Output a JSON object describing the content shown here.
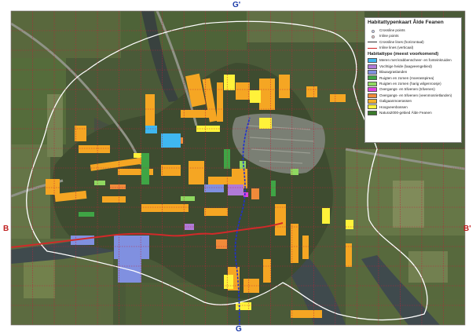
{
  "labels": {
    "top": "G'",
    "bottom": "G",
    "left": "B",
    "right": "B'"
  },
  "legend": {
    "title": "Habitattypenkaart Âlde Feanen",
    "line_items": [
      {
        "label": "Crossline points",
        "kind": "point",
        "color": "#cfd8ff"
      },
      {
        "label": "Inline points",
        "kind": "point",
        "color": "#ffd0d0"
      },
      {
        "label": "Crossline lines (horizontaal)",
        "kind": "line",
        "color": "#333333"
      },
      {
        "label": "Inline lines (verticaal)",
        "kind": "line",
        "color": "#d02020"
      }
    ],
    "subtitle": "Habitattype (meest voorkomend)",
    "habitat_items": [
      {
        "label": "Meren met krabbenscheer- en fonteinkruiden",
        "color": "#3fb7f0"
      },
      {
        "label": "Vochtige heide (laagveengebied)",
        "color": "#b07ad8"
      },
      {
        "label": "Blauwgraslanden",
        "color": "#8090e0"
      },
      {
        "label": "Ruigten en zomen (moerasspirea)",
        "color": "#3fa545"
      },
      {
        "label": "Ruigten en zomen (harig wilgenroosje)",
        "color": "#8fd860"
      },
      {
        "label": "Overgangs- en trilvenen (trilvenen)",
        "color": "#e040e0"
      },
      {
        "label": "Overgangs- en trilvenen (veenmosrietlanden)",
        "color": "#f08a3a"
      },
      {
        "label": "Galigaanmoerassen",
        "color": "#f5b028"
      },
      {
        "label": "Hoogveenbossen",
        "color": "#fff23a"
      },
      {
        "label": "Natura2000-gebied Âlde Feanen",
        "color": "#3a7a2a"
      }
    ]
  },
  "colors": {
    "grid_line": "#c0203a",
    "crossline": "#d02a2a",
    "inline": "#2030d0",
    "boundary": "#ffffff",
    "water": "#3f4a4d",
    "label_blue": "#1a3aa8",
    "label_red": "#c02020"
  }
}
